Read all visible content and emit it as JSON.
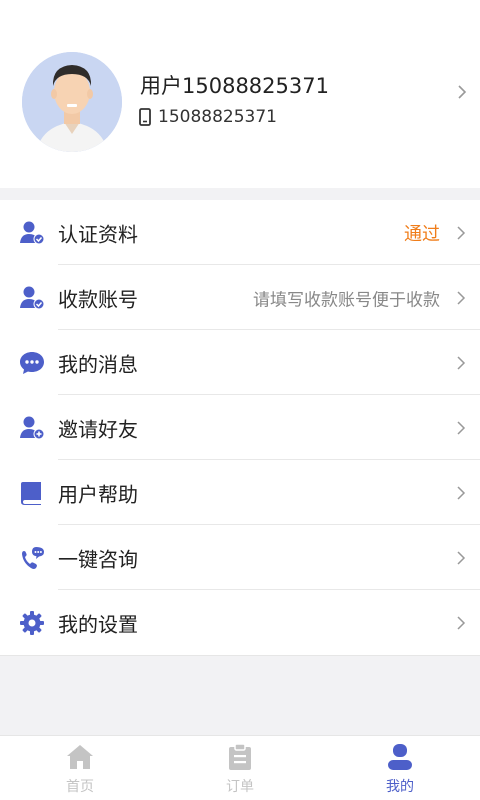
{
  "colors": {
    "accent": "#4d5fc9",
    "pass": "#f07d1a",
    "muted": "#888888",
    "tab_inactive": "#c4c4c4"
  },
  "profile": {
    "name": "用户15088825371",
    "phone": "15088825371",
    "phone_icon": "phone-icon",
    "avatar_icon": "avatar-icon"
  },
  "menu": {
    "items": [
      {
        "label": "认证资料",
        "value": "通过",
        "icon": "verified-user-icon"
      },
      {
        "label": "收款账号",
        "value": "请填写收款账号便于收款",
        "icon": "account-user-icon"
      },
      {
        "label": "我的消息",
        "value": "",
        "icon": "message-icon"
      },
      {
        "label": "邀请好友",
        "value": "",
        "icon": "add-friend-icon"
      },
      {
        "label": "用户帮助",
        "value": "",
        "icon": "book-icon"
      },
      {
        "label": "一键咨询",
        "value": "",
        "icon": "phone-chat-icon"
      },
      {
        "label": "我的设置",
        "value": "",
        "icon": "gear-icon"
      }
    ]
  },
  "tabbar": {
    "tabs": [
      {
        "label": "首页",
        "icon": "home-icon",
        "active": false
      },
      {
        "label": "订单",
        "icon": "clipboard-icon",
        "active": false
      },
      {
        "label": "我的",
        "icon": "user-icon",
        "active": true
      }
    ]
  }
}
